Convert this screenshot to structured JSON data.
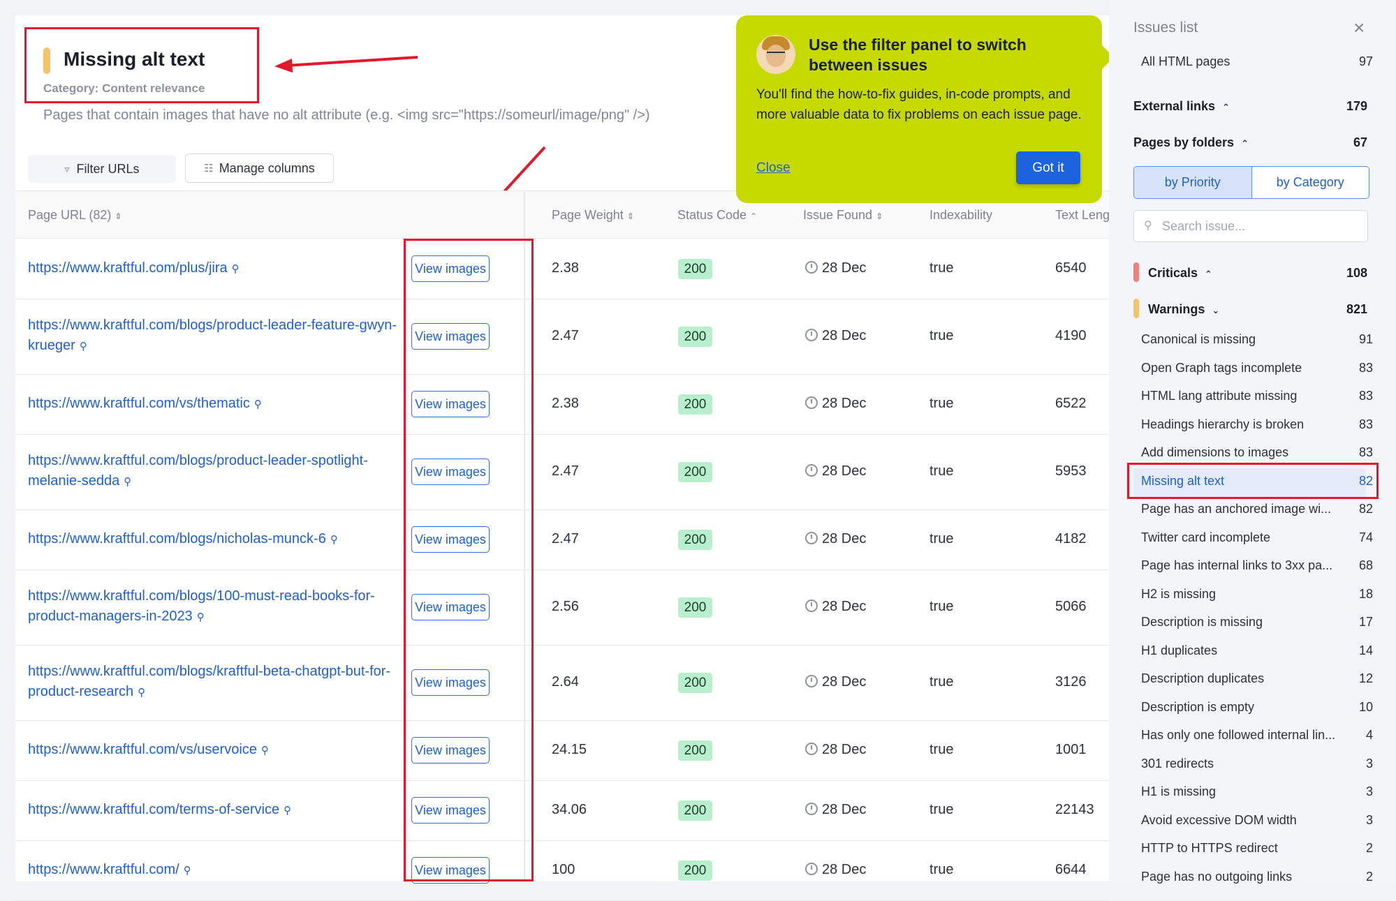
{
  "header": {
    "title": "Missing alt text",
    "category": "Category: Content relevance",
    "description": "Pages that contain images that have no alt attribute (e.g. <img src=\"https://someurl/image/png\" />)"
  },
  "toolbar": {
    "filter_label": "Filter URLs",
    "manage_label": "Manage columns"
  },
  "table": {
    "headers": [
      "Page URL (82)",
      "Page Weight",
      "Status Code",
      "Issue Found",
      "Indexability",
      "Text Leng"
    ],
    "rows": [
      {
        "url": "https://www.kraftful.com/plus/jira",
        "button": "View images",
        "weight": "2.38",
        "status": "200",
        "found": "28 Dec",
        "index": "true",
        "text": "6540"
      },
      {
        "url": "https://www.kraftful.com/blogs/product-leader-feature-gwyn-krueger",
        "button": "View images",
        "weight": "2.47",
        "status": "200",
        "found": "28 Dec",
        "index": "true",
        "text": "4190"
      },
      {
        "url": "https://www.kraftful.com/vs/thematic",
        "button": "View images",
        "weight": "2.38",
        "status": "200",
        "found": "28 Dec",
        "index": "true",
        "text": "6522"
      },
      {
        "url": "https://www.kraftful.com/blogs/product-leader-spotlight-melanie-sedda",
        "button": "View images",
        "weight": "2.47",
        "status": "200",
        "found": "28 Dec",
        "index": "true",
        "text": "5953"
      },
      {
        "url": "https://www.kraftful.com/blogs/nicholas-munck-6",
        "button": "View images",
        "weight": "2.47",
        "status": "200",
        "found": "28 Dec",
        "index": "true",
        "text": "4182"
      },
      {
        "url": "https://www.kraftful.com/blogs/100-must-read-books-for-product-managers-in-2023",
        "button": "View images",
        "weight": "2.56",
        "status": "200",
        "found": "28 Dec",
        "index": "true",
        "text": "5066"
      },
      {
        "url": "https://www.kraftful.com/blogs/kraftful-beta-chatgpt-but-for-product-research",
        "button": "View images",
        "weight": "2.64",
        "status": "200",
        "found": "28 Dec",
        "index": "true",
        "text": "3126"
      },
      {
        "url": "https://www.kraftful.com/vs/uservoice",
        "button": "View images",
        "weight": "24.15",
        "status": "200",
        "found": "28 Dec",
        "index": "true",
        "text": "1001"
      },
      {
        "url": "https://www.kraftful.com/terms-of-service",
        "button": "View images",
        "weight": "34.06",
        "status": "200",
        "found": "28 Dec",
        "index": "true",
        "text": "22143"
      },
      {
        "url": "https://www.kraftful.com/",
        "button": "View images",
        "weight": "100",
        "status": "200",
        "found": "28 Dec",
        "index": "true",
        "text": "6644"
      }
    ]
  },
  "popup": {
    "title": "Use the filter panel to switch between issues",
    "text": "You'll find the how-to-fix guides, in-code prompts, and more valuable data to fix problems on each issue page.",
    "close": "Close",
    "got_it": "Got it"
  },
  "sidebar": {
    "title": "Issues list",
    "all_pages": {
      "label": "All HTML pages",
      "count": "97"
    },
    "external": {
      "label": "External links",
      "count": "179"
    },
    "folders": {
      "label": "Pages by folders",
      "count": "67"
    },
    "toggle": [
      "by Priority",
      "by Category"
    ],
    "search_placeholder": "Search issue...",
    "criticals": {
      "label": "Criticals",
      "count": "108",
      "color": "#f07f7f"
    },
    "warnings": {
      "label": "Warnings",
      "count": "821",
      "color": "#f7c36a"
    },
    "items": [
      {
        "label": "Canonical is missing",
        "count": "91"
      },
      {
        "label": "Open Graph tags incomplete",
        "count": "83"
      },
      {
        "label": "HTML lang attribute missing",
        "count": "83"
      },
      {
        "label": "Headings hierarchy is broken",
        "count": "83"
      },
      {
        "label": "Add dimensions to images",
        "count": "83"
      },
      {
        "label": "Missing alt text",
        "count": "82"
      },
      {
        "label": "Page has an anchored image wi...",
        "count": "82"
      },
      {
        "label": "Twitter card incomplete",
        "count": "74"
      },
      {
        "label": "Page has internal links to 3xx pa...",
        "count": "68"
      },
      {
        "label": "H2 is missing",
        "count": "18"
      },
      {
        "label": "Description is missing",
        "count": "17"
      },
      {
        "label": "H1 duplicates",
        "count": "14"
      },
      {
        "label": "Description duplicates",
        "count": "12"
      },
      {
        "label": "Description is empty",
        "count": "10"
      },
      {
        "label": "Has only one followed internal lin...",
        "count": "4"
      },
      {
        "label": "301 redirects",
        "count": "3"
      },
      {
        "label": "H1 is missing",
        "count": "3"
      },
      {
        "label": "Avoid excessive DOM width",
        "count": "3"
      },
      {
        "label": "HTTP to HTTPS redirect",
        "count": "2"
      },
      {
        "label": "Page has no outgoing links",
        "count": "2"
      }
    ]
  }
}
